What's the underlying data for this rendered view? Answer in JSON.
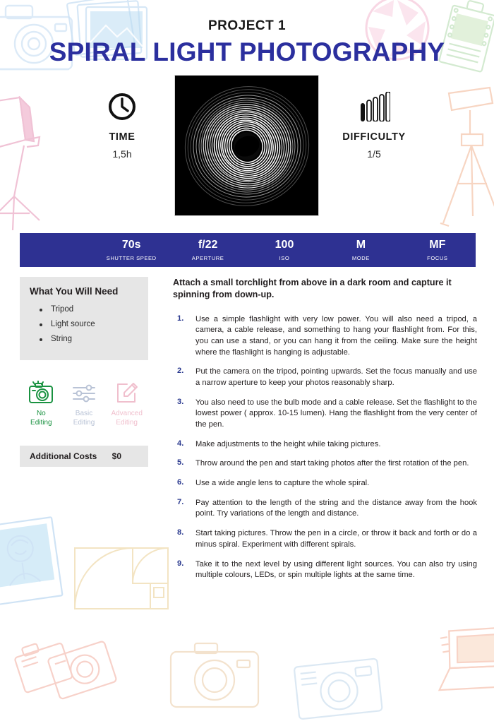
{
  "header": {
    "project_label": "PROJECT 1",
    "title": "SPIRAL LIGHT PHOTOGRAPHY",
    "title_color": "#2b2f9e"
  },
  "hero": {
    "photo_alt": "spiral-light-long-exposure-photo",
    "time": {
      "icon": "clock-icon",
      "label": "TIME",
      "value": "1,5h"
    },
    "difficulty": {
      "icon": "signal-bars-icon",
      "label": "DIFFICULTY",
      "value": "1/5",
      "level": 1,
      "max": 5
    }
  },
  "specs": {
    "bar_color": "#2e3192",
    "items": [
      {
        "value": "70s",
        "name": "SHUTTER SPEED"
      },
      {
        "value": "f/22",
        "name": "APERTURE"
      },
      {
        "value": "100",
        "name": "ISO"
      },
      {
        "value": "M",
        "name": "MODE"
      },
      {
        "value": "MF",
        "name": "FOCUS"
      }
    ]
  },
  "sidebar": {
    "needs": {
      "title": "What You Will Need",
      "items": [
        "Tripod",
        "Light source",
        "String"
      ]
    },
    "editing": [
      {
        "icon": "camera-icon",
        "line1": "No",
        "line2": "Editing",
        "state": "active",
        "color": "#1a9241"
      },
      {
        "icon": "sliders-icon",
        "line1": "Basic",
        "line2": "Editing",
        "state": "inactive",
        "color": "#b9c3d6"
      },
      {
        "icon": "pencil-edit-icon",
        "line1": "Advanced",
        "line2": "Editing",
        "state": "inactive",
        "color": "#f0bfcd"
      }
    ],
    "costs": {
      "label": "Additional Costs",
      "value": "$0"
    }
  },
  "content": {
    "intro": "Attach a small torchlight from above in a dark room and capture it spinning from down-up.",
    "steps": [
      {
        "num": "1.",
        "text": "Use a simple flashlight with very low power. You will also need a tripod, a camera, a cable release, and something to hang your flashlight from. For this, you can use a stand, or you can hang it from the ceiling. Make sure the height where the flashlight is hanging is adjustable."
      },
      {
        "num": "2.",
        "text": "Put the camera on the tripod, pointing upwards. Set the focus manually and use a narrow aperture to keep your photos reasonably sharp."
      },
      {
        "num": "3.",
        "text": "You also need to use the bulb mode and a cable release. Set the flashlight to the lowest power ( approx. 10-15 lumen). Hang the flashlight from the very center of the pen."
      },
      {
        "num": "4.",
        "text": "Make adjustments to the height while taking pictures."
      },
      {
        "num": "5.",
        "text": "Throw around the pen and start taking photos after the first rotation of the pen."
      },
      {
        "num": "6.",
        "text": "Use a wide angle lens to capture the whole spiral."
      },
      {
        "num": "7.",
        "text": "Pay attention to the length of the string and the distance away from the hook point. Try variations of the length and distance."
      },
      {
        "num": "8.",
        "text": "Start taking pictures. Throw the pen in a circle, or throw it back and forth or do a minus spiral. Experiment with different spirals."
      },
      {
        "num": "9.",
        "text": "Take it to the next level by using different light sources. You can also try using multiple colours, LEDs, or spin multiple lights at the same time."
      }
    ]
  }
}
